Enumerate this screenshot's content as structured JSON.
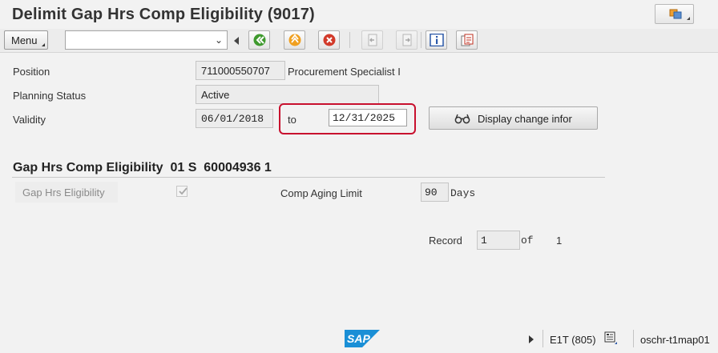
{
  "title": "Delimit Gap Hrs Comp Eligibility (9017)",
  "toolbar": {
    "menu_label": "Menu",
    "command_value": ""
  },
  "header": {
    "position_label": "Position",
    "position_id": "711000550707",
    "position_name": "Procurement Specialist I",
    "planning_status_label": "Planning Status",
    "planning_status_value": "Active",
    "validity_label": "Validity",
    "validity_from": "06/01/2018",
    "to_label": "to",
    "validity_to": "12/31/2025",
    "display_change_button": "Display change infor"
  },
  "section": {
    "title": "Gap Hrs Comp Eligibility  01 S  60004936 1",
    "gap_hrs_eligibility_label": "Gap Hrs Eligibility",
    "gap_hrs_eligibility_checked": true,
    "comp_aging_limit_label": "Comp Aging Limit",
    "comp_aging_limit_value": "90",
    "comp_aging_unit": "Days",
    "record_label": "Record",
    "record_value": "1",
    "of_label": "of",
    "record_total": "1"
  },
  "statusbar": {
    "logo_text": "SAP",
    "system": "E1T (805)",
    "server": "oschr-t1map01"
  },
  "colors": {
    "highlight": "#c8102e",
    "sap_logo": "#1a8fd6"
  }
}
